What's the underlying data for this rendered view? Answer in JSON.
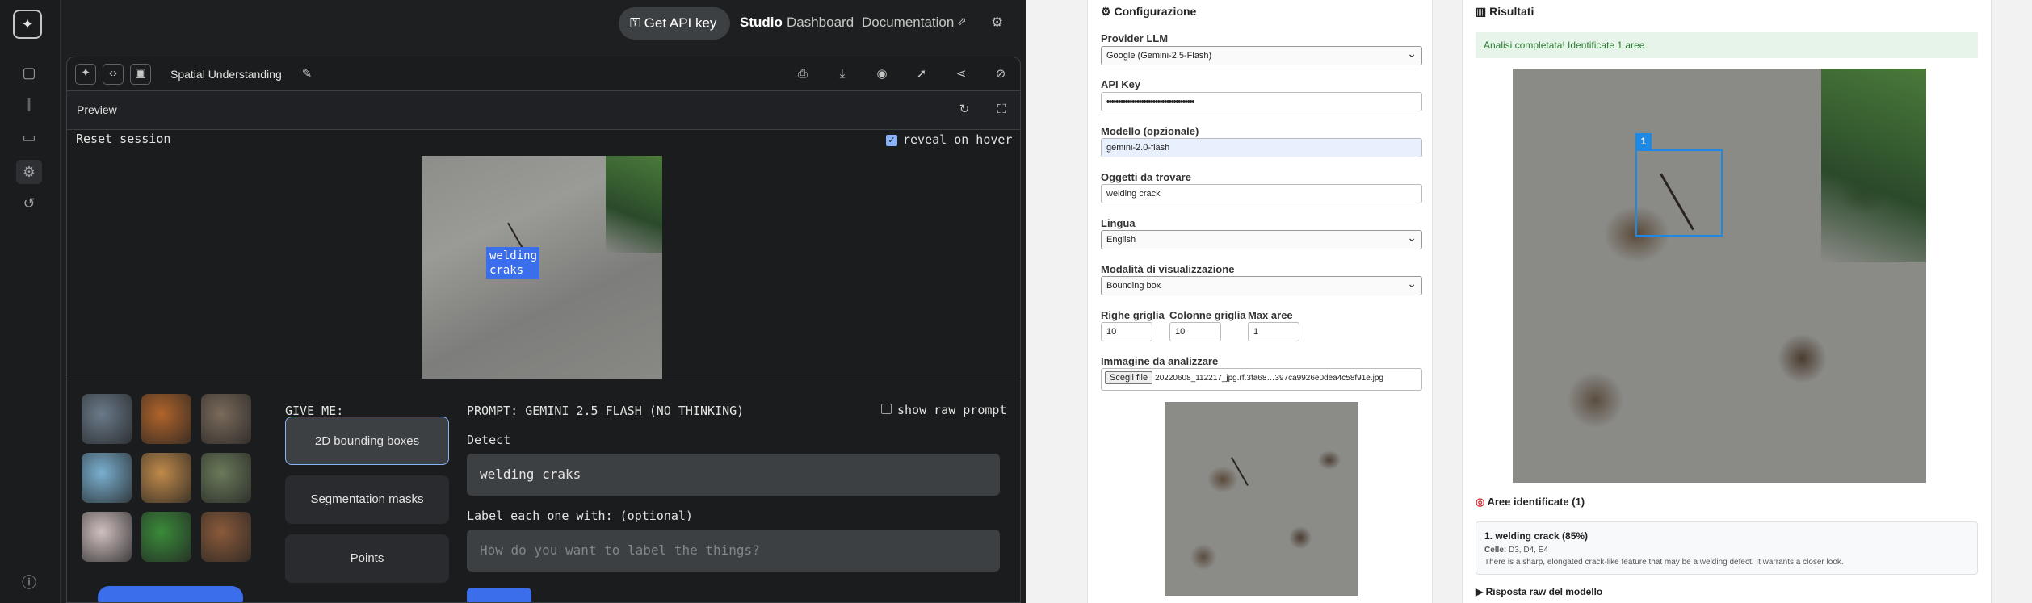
{
  "studio": {
    "topbar": {
      "api_key": "Get API key",
      "studio": "Studio",
      "dashboard": "Dashboard",
      "documentation": "Documentation"
    },
    "app_title": "Spatial Understanding",
    "preview_label": "Preview",
    "reset_session": "Reset session",
    "reveal_on_hover": "reveal on hover",
    "detection_label": "welding\ncraks",
    "give_me": "GIVE ME:",
    "options": [
      "2D bounding boxes",
      "Segmentation masks",
      "Points"
    ],
    "prompt_title": "PROMPT: GEMINI 2.5 FLASH (NO THINKING)",
    "show_raw_prompt": "show raw prompt",
    "detect_label": "Detect",
    "detect_value": "welding craks",
    "label_each": "Label each one with: (optional)",
    "label_placeholder": "How do you want to label the things?",
    "thumb_colors": [
      "#6a7a8a",
      "#b0642a",
      "#7a6a5a",
      "#7ab0d0",
      "#c08a4a",
      "#6a7a5a",
      "#d0c0c0",
      "#3a8a3a",
      "#8a5a3a"
    ]
  },
  "config": {
    "title": "Configurazione",
    "provider_label": "Provider LLM",
    "provider_value": "Google (Gemini-2.5-Flash)",
    "apikey_label": "API Key",
    "apikey_value": "••••••••••••••••••••••••••••••••••••••",
    "model_label": "Modello (opzionale)",
    "model_value": "gemini-2.0-flash",
    "objects_label": "Oggetti da trovare",
    "objects_value": "welding crack",
    "lang_label": "Lingua",
    "lang_value": "English",
    "mode_label": "Modalità di visualizzazione",
    "mode_value": "Bounding box",
    "rows_label": "Righe griglia",
    "rows_value": "10",
    "cols_label": "Colonne griglia",
    "cols_value": "10",
    "max_label": "Max aree",
    "max_value": "1",
    "image_label": "Immagine da analizzare",
    "file_button": "Scegli file",
    "file_name": "20220608_112217_jpg.rf.3fa68…397ca9926e0dea4c58f91e.jpg"
  },
  "results": {
    "title": "Risultati",
    "success": "Analisi completata! Identificate 1 aree.",
    "box_number": "1",
    "areas_title": "Aree identificate (1)",
    "area_title": "1. welding crack (85%)",
    "cells_label": "Celle:",
    "cells_value": "D3, D4, E4",
    "area_desc": "There is a sharp, elongated crack-like feature that may be a welding defect. It warrants a closer look.",
    "raw_toggle": "Risposta raw del modello"
  }
}
